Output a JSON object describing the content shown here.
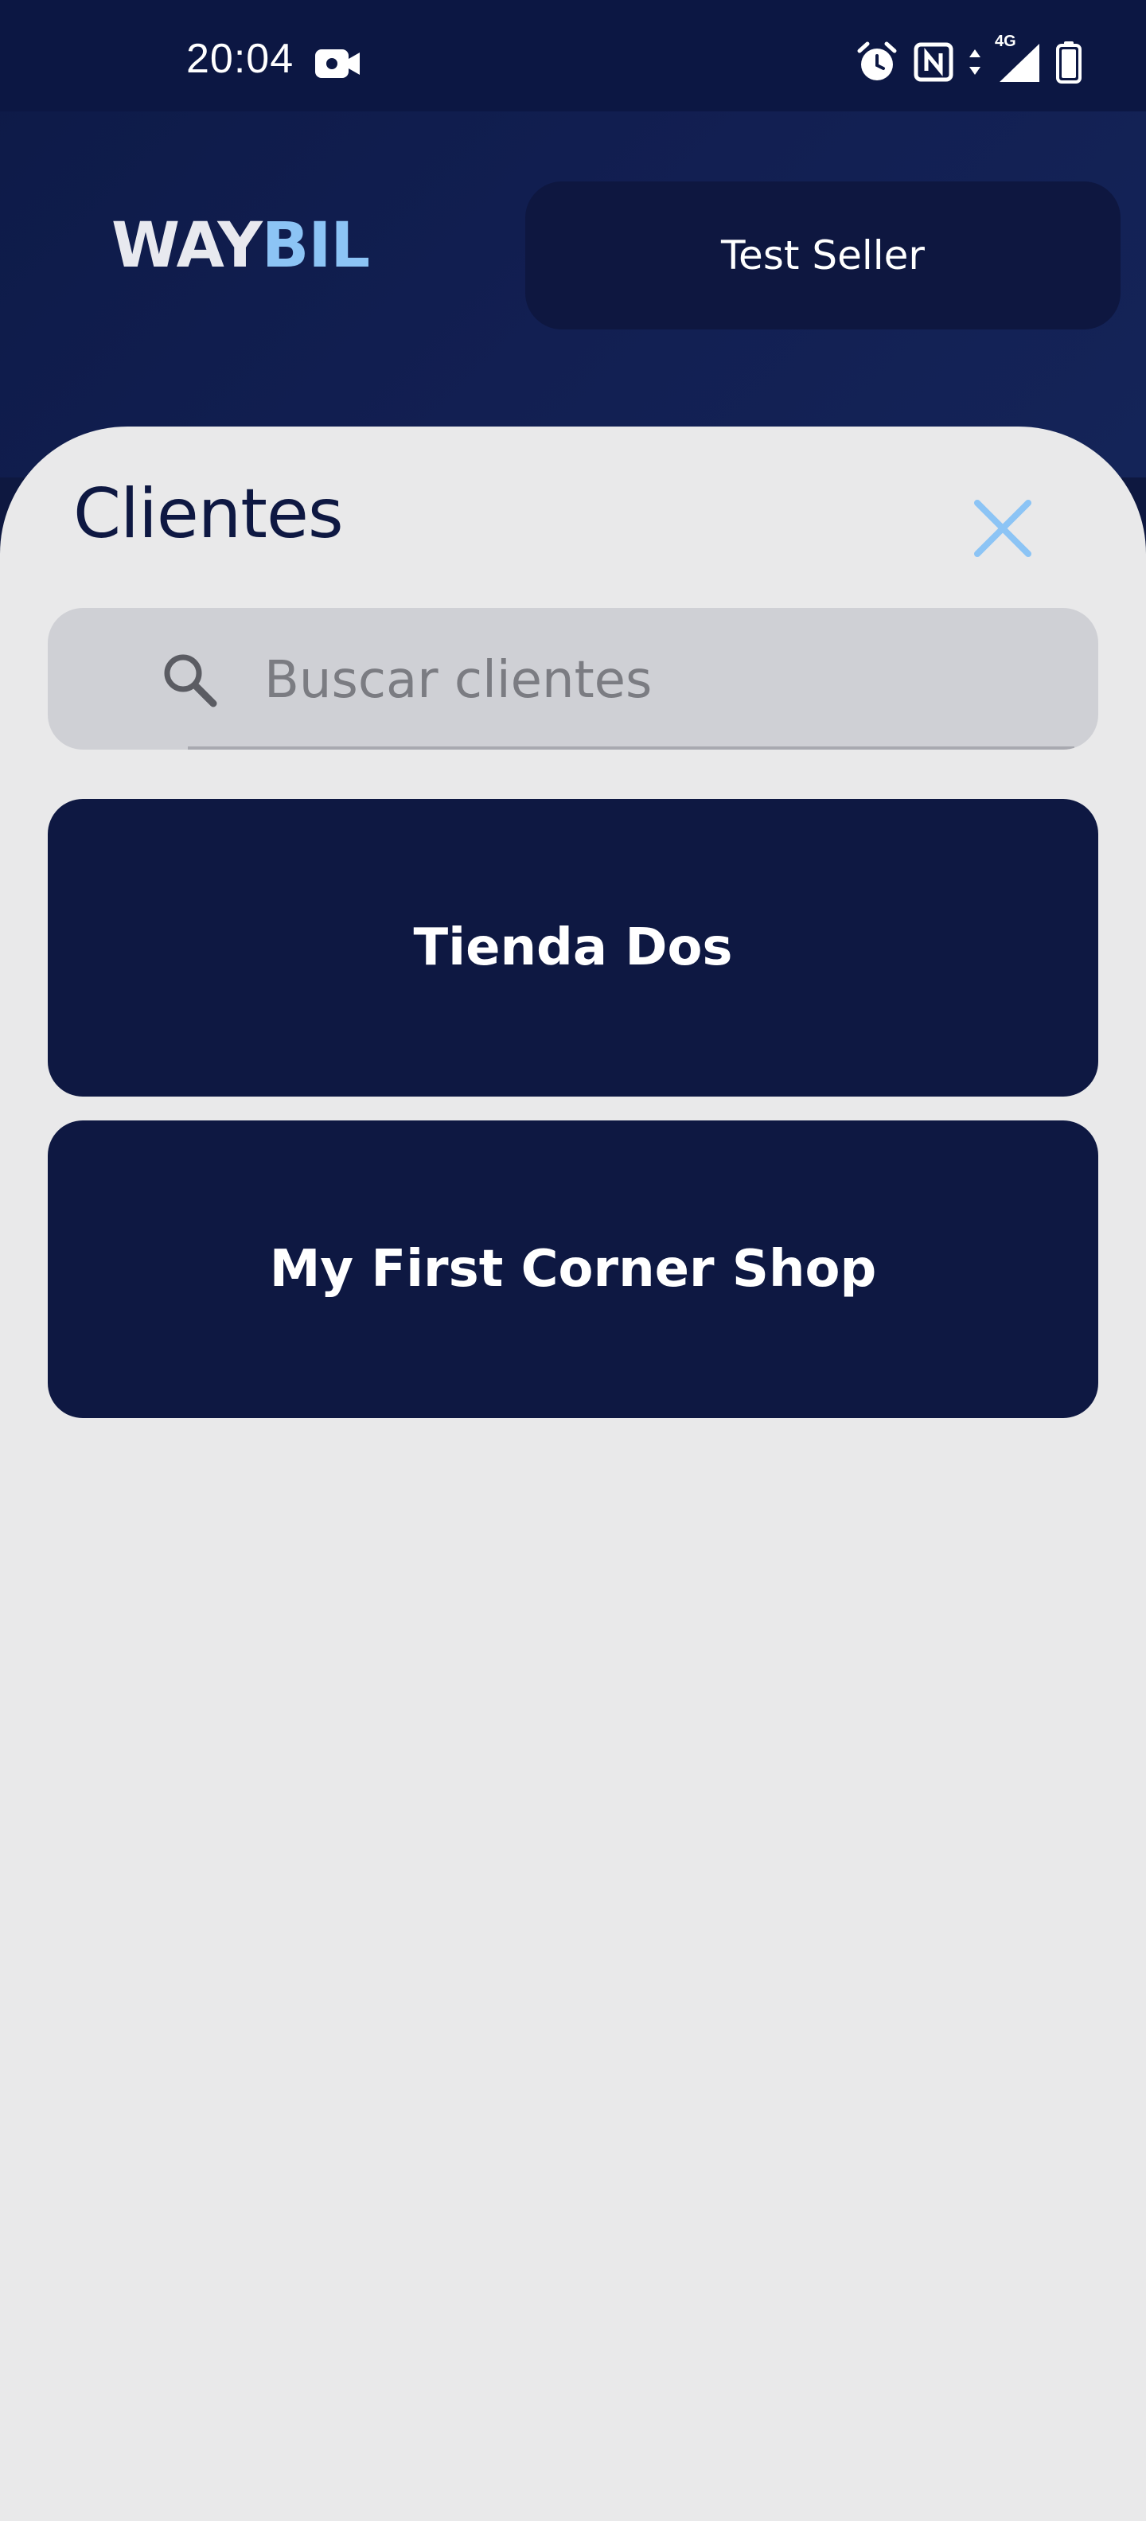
{
  "status_bar": {
    "time": "20:04",
    "network": "4G",
    "icons": [
      "video-camera-icon",
      "alarm-icon",
      "nfc-icon",
      "signal-icon",
      "battery-icon"
    ]
  },
  "header": {
    "logo": {
      "part1": "WAY",
      "part2": "BIL"
    },
    "seller_label": "Test Seller"
  },
  "sheet": {
    "title": "Clientes",
    "close_icon": "close-icon",
    "search": {
      "placeholder": "Buscar clientes",
      "value": "",
      "icon": "search-icon"
    },
    "clients": [
      {
        "label": "Tienda Dos"
      },
      {
        "label": "My First Corner Shop"
      }
    ]
  },
  "colors": {
    "primary": "#0e1842",
    "accent": "#8cc4f5",
    "sheet_bg": "#e9e9ea",
    "search_bg": "#cfd0d5"
  }
}
